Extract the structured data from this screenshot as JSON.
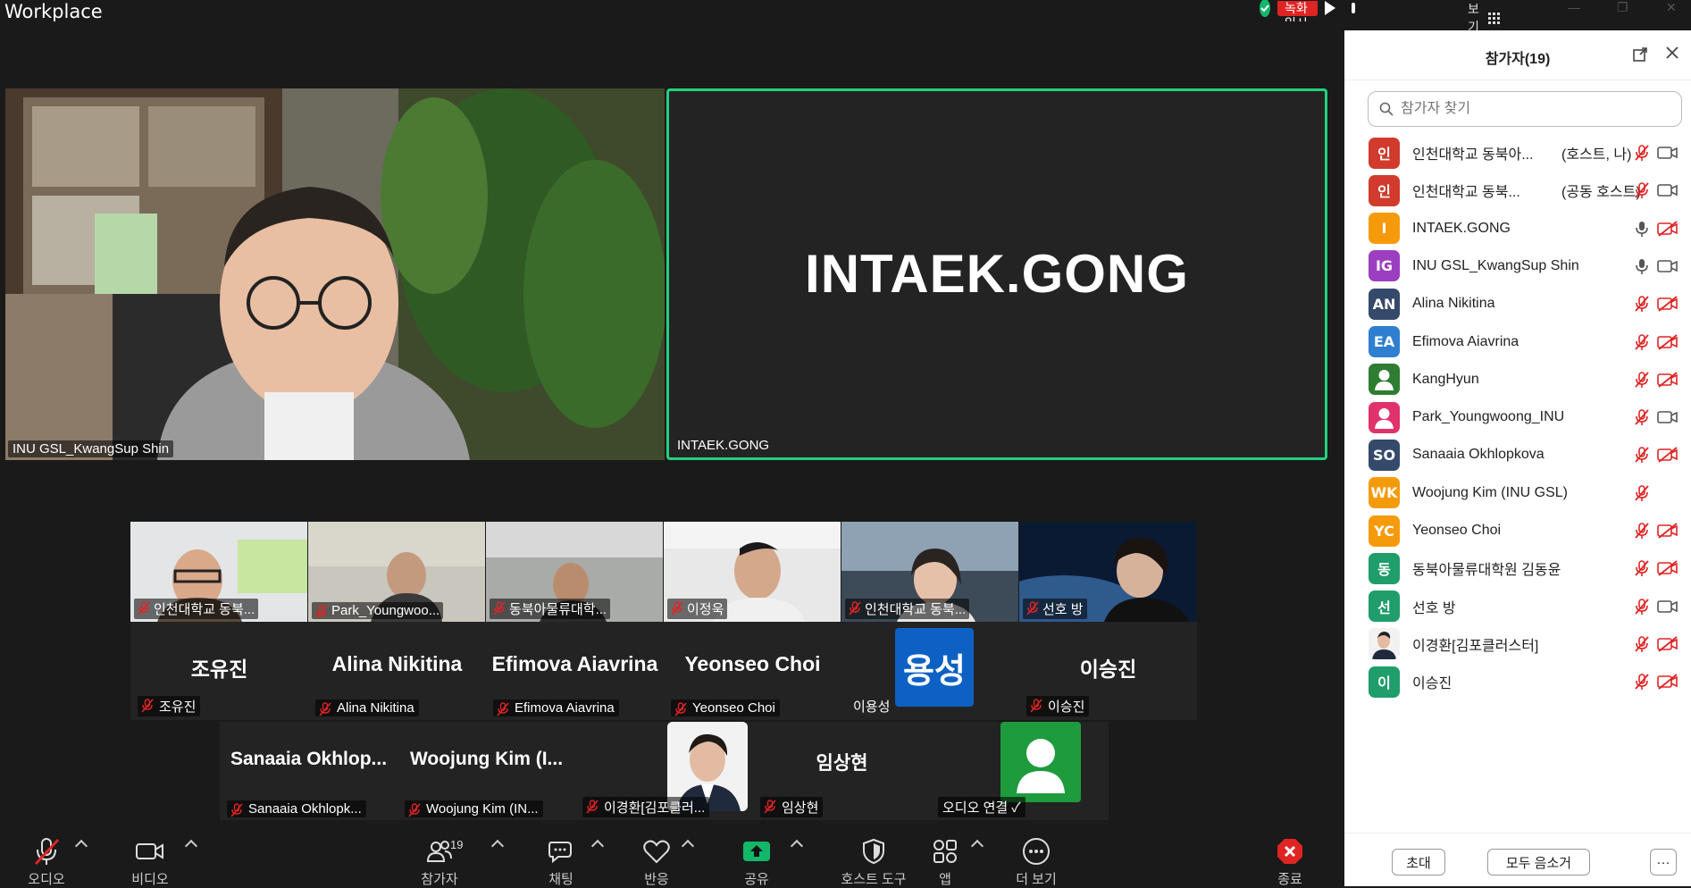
{
  "app": {
    "title": "Workplace"
  },
  "recording": {
    "label": "녹화 일시 중지됨"
  },
  "view": {
    "label": "보기"
  },
  "main_video": {
    "name": "INU GSL_KwangSup Shin"
  },
  "active_speaker": {
    "big_name": "INTAEK.GONG",
    "name": "INTAEK.GONG"
  },
  "gallery": {
    "video_tiles": [
      {
        "name": "인천대학교 동북..."
      },
      {
        "name": "Park_Youngwoo..."
      },
      {
        "name": "동북아물류대학..."
      },
      {
        "name": "이정욱"
      },
      {
        "name": "인천대학교 동북..."
      },
      {
        "name": "선호 방"
      }
    ],
    "name_tiles": [
      {
        "big": "조유진",
        "name": "조유진"
      },
      {
        "big": "Alina Nikitina",
        "name": "Alina Nikitina"
      },
      {
        "big": "Efimova Aiavrina",
        "name": "Efimova Aiavrina"
      },
      {
        "big": "Yeonseo Choi",
        "name": "Yeonseo Choi"
      },
      {
        "avatar": "용성",
        "name": "이용성"
      },
      {
        "big": "이승진",
        "name": "이승진"
      }
    ],
    "bottom_tiles": [
      {
        "big": "Sanaaia  Okhlop...",
        "name": "Sanaaia Okhlopk..."
      },
      {
        "big": "Woojung  Kim  (I...",
        "name": "Woojung Kim (IN..."
      },
      {
        "name": "이경환[김포클러..."
      },
      {
        "big": "임상현",
        "name": "임상현"
      },
      {
        "name": "오디오 연결"
      }
    ]
  },
  "toolbar": {
    "audio": "오디오",
    "video": "비디오",
    "participants": "참가자",
    "participants_count": "19",
    "chat": "채팅",
    "reactions": "반응",
    "share": "공유",
    "host_tools": "호스트 도구",
    "apps": "앱",
    "more": "더 보기",
    "end": "종료"
  },
  "panel": {
    "title": "참가자(19)",
    "search_placeholder": "참가자 찾기",
    "invite": "초대",
    "mute_all": "모두 음소거",
    "more": "···",
    "participants": [
      {
        "initials": "인",
        "color": "#d13b2e",
        "name": "인천대학교 동북아...",
        "role": "(호스트, 나)",
        "mic": "muted",
        "cam": "on"
      },
      {
        "initials": "인",
        "color": "#d13b2e",
        "name": "인천대학교 동북...",
        "role": "(공동 호스트)",
        "mic": "muted",
        "cam": "on"
      },
      {
        "initials": "I",
        "color": "#f59b0b",
        "name": "INTAEK.GONG",
        "role": "",
        "mic": "on",
        "cam": "off"
      },
      {
        "initials": "IG",
        "color": "#9b3fc0",
        "name": "INU GSL_KwangSup Shin",
        "role": "",
        "mic": "on",
        "cam": "on"
      },
      {
        "initials": "AN",
        "color": "#35496b",
        "name": "Alina Nikitina",
        "role": "",
        "mic": "muted",
        "cam": "off"
      },
      {
        "initials": "EA",
        "color": "#2f7fd0",
        "name": "Efimova Aiavrina",
        "role": "",
        "mic": "muted",
        "cam": "off"
      },
      {
        "initials": "",
        "color": "#2e7d32",
        "name": "KangHyun",
        "role": "",
        "mic": "muted",
        "cam": "off"
      },
      {
        "initials": "",
        "color": "#e0336b",
        "name": "Park_Youngwoong_INU",
        "role": "",
        "mic": "muted",
        "cam": "on"
      },
      {
        "initials": "SO",
        "color": "#35496b",
        "name": "Sanaaia Okhlopkova",
        "role": "",
        "mic": "muted",
        "cam": "off"
      },
      {
        "initials": "WK",
        "color": "#f59b0b",
        "name": "Woojung Kim (INU GSL)",
        "role": "",
        "mic": "muted",
        "cam": ""
      },
      {
        "initials": "YC",
        "color": "#f59b0b",
        "name": "Yeonseo Choi",
        "role": "",
        "mic": "muted",
        "cam": "off"
      },
      {
        "initials": "동",
        "color": "#1f9d6a",
        "name": "동북아물류대학원 김동윤",
        "role": "",
        "mic": "muted",
        "cam": "off"
      },
      {
        "initials": "선",
        "color": "#1f9d6a",
        "name": "선호 방",
        "role": "",
        "mic": "muted",
        "cam": "on"
      },
      {
        "initials": "",
        "color": "#eeeeee",
        "name": "이경환[김포클러스터]",
        "role": "",
        "mic": "muted",
        "cam": "off"
      },
      {
        "initials": "이",
        "color": "#1f9d6a",
        "name": "이승진",
        "role": "",
        "mic": "muted",
        "cam": "off"
      }
    ]
  }
}
